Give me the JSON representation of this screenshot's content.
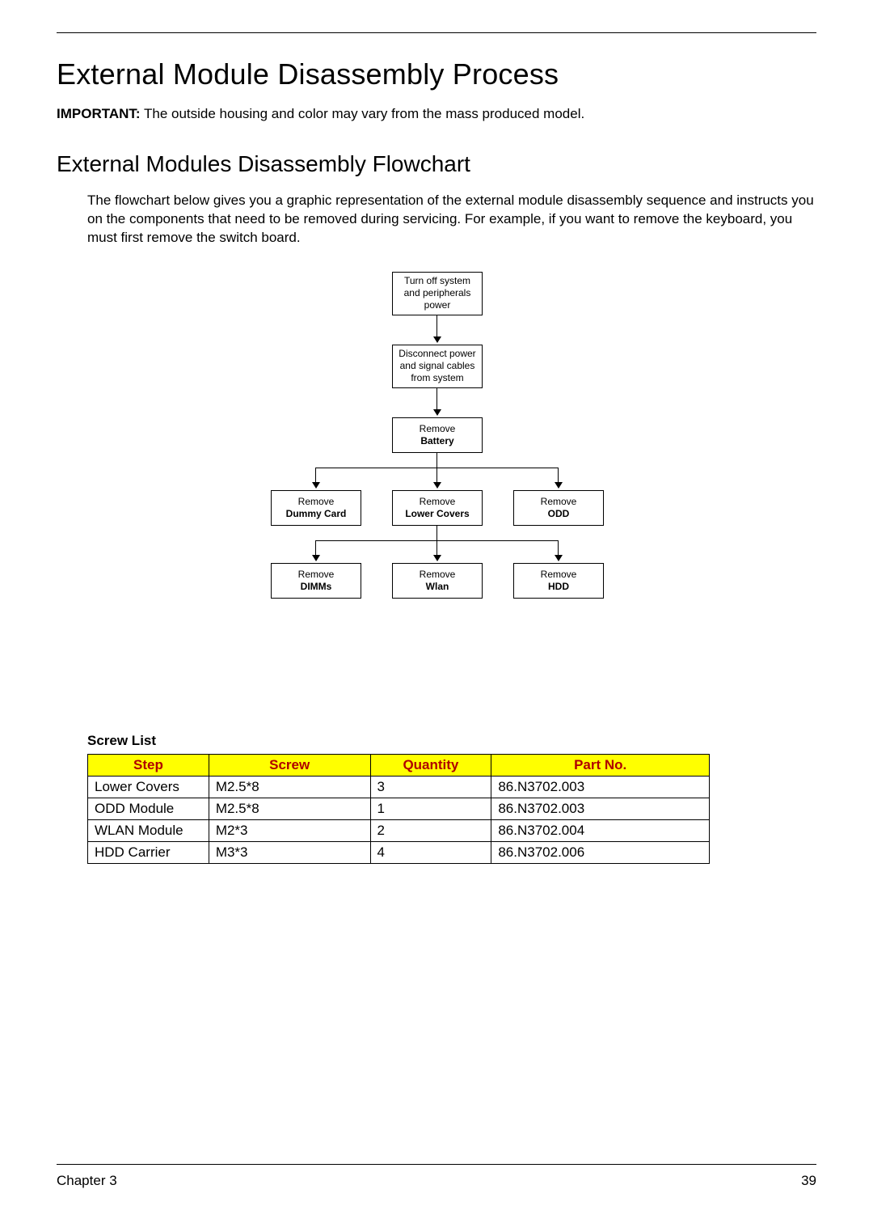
{
  "title": "External Module Disassembly Process",
  "important_label": "IMPORTANT:",
  "important_text": " The outside housing and color may vary from the mass produced model.",
  "subtitle": "External Modules Disassembly Flowchart",
  "bodytext": "The flowchart below gives you a graphic representation of the external module disassembly sequence and instructs you on the components that need to be removed during servicing. For example, if you want to remove the keyboard, you must first remove the switch board.",
  "flow": {
    "n1_l1": "Turn off system",
    "n1_l2": "and peripherals",
    "n1_l3": "power",
    "n2_l1": "Disconnect power",
    "n2_l2": "and signal cables",
    "n2_l3": "from system",
    "n3_l1": "Remove",
    "n3_l2": "Battery",
    "n4a_l1": "Remove",
    "n4a_l2": "Dummy Card",
    "n4b_l1": "Remove",
    "n4b_l2": "Lower Covers",
    "n4c_l1": "Remove",
    "n4c_l2": "ODD",
    "n5a_l1": "Remove",
    "n5a_l2": "DIMMs",
    "n5b_l1": "Remove",
    "n5b_l2": "Wlan",
    "n5c_l1": "Remove",
    "n5c_l2": "HDD"
  },
  "screw_heading": "Screw List",
  "table": {
    "headers": {
      "step": "Step",
      "screw": "Screw",
      "qty": "Quantity",
      "part": "Part No."
    },
    "rows": [
      {
        "step": "Lower Covers",
        "screw": "M2.5*8",
        "qty": "3",
        "part": "86.N3702.003"
      },
      {
        "step": "ODD Module",
        "screw": "M2.5*8",
        "qty": "1",
        "part": "86.N3702.003"
      },
      {
        "step": "WLAN Module",
        "screw": "M2*3",
        "qty": "2",
        "part": "86.N3702.004"
      },
      {
        "step": "HDD Carrier",
        "screw": "M3*3",
        "qty": "4",
        "part": "86.N3702.006"
      }
    ]
  },
  "footer": {
    "left": "Chapter 3",
    "right": "39"
  }
}
